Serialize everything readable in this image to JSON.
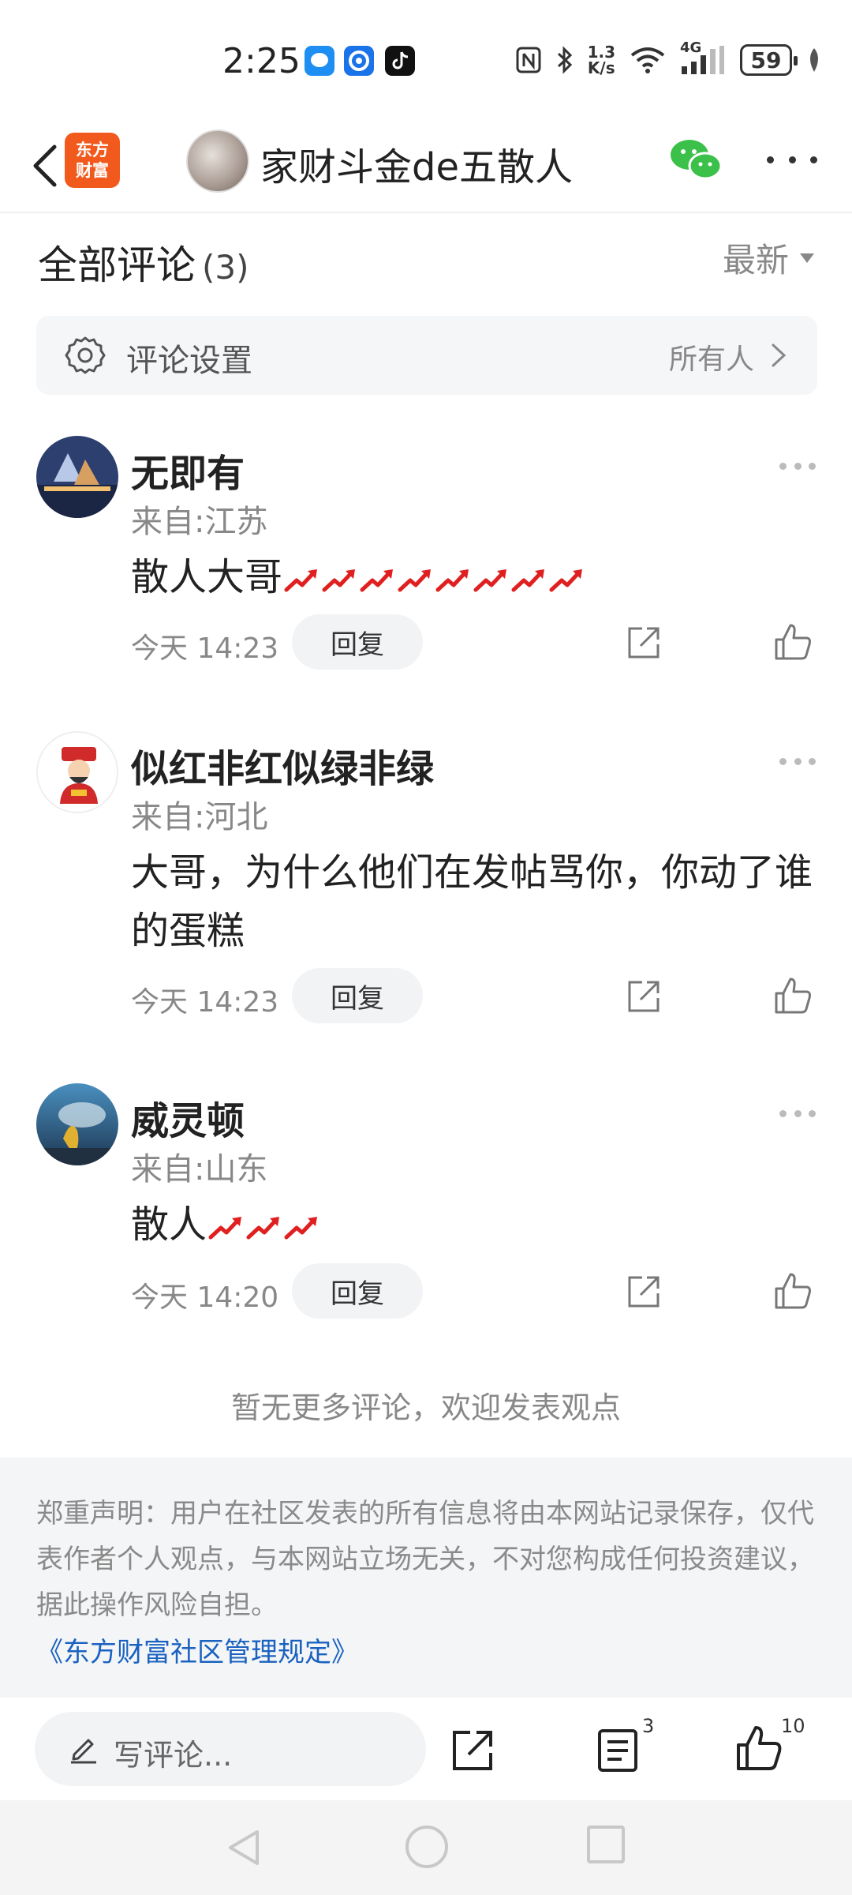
{
  "status_bar": {
    "time": "2:25",
    "net_speed_value": "1.3",
    "net_speed_unit": "K/s",
    "network_type": "4G",
    "battery": "59"
  },
  "header": {
    "brand_logo_line1": "东方",
    "brand_logo_line2": "财富",
    "author_name": "家财斗金de五散人"
  },
  "comments_section": {
    "title": "全部评论",
    "count": "(3)",
    "sort": "最新",
    "settings_label": "评论设置",
    "settings_value": "所有人"
  },
  "comments": [
    {
      "name": "无即有",
      "location": "来自:江苏",
      "text": "散人大哥",
      "rise_icons": 8,
      "time": "今天 14:23",
      "reply_label": "回复"
    },
    {
      "name": "似红非红似绿非绿",
      "location": "来自:河北",
      "text": "大哥，为什么他们在发帖骂你，你动了谁的蛋糕",
      "rise_icons": 0,
      "time": "今天 14:23",
      "reply_label": "回复"
    },
    {
      "name": "威灵顿",
      "location": "来自:山东",
      "text": "散人",
      "rise_icons": 3,
      "time": "今天 14:20",
      "reply_label": "回复"
    }
  ],
  "no_more_text": "暂无更多评论，欢迎发表观点",
  "disclaimer": {
    "text": "郑重声明：用户在社区发表的所有信息将由本网站记录保存，仅代表作者个人观点，与本网站立场无关，不对您构成任何投资建议，据此操作风险自担。",
    "link": "《东方财富社区管理规定》"
  },
  "bottom_bar": {
    "write_placeholder": "写评论...",
    "comments_count": "3",
    "likes_count": "10"
  },
  "colors": {
    "brand": "#f25a1d",
    "link": "#1a62c0",
    "rise_red": "#e02020",
    "wechat_green": "#3bc14a"
  }
}
